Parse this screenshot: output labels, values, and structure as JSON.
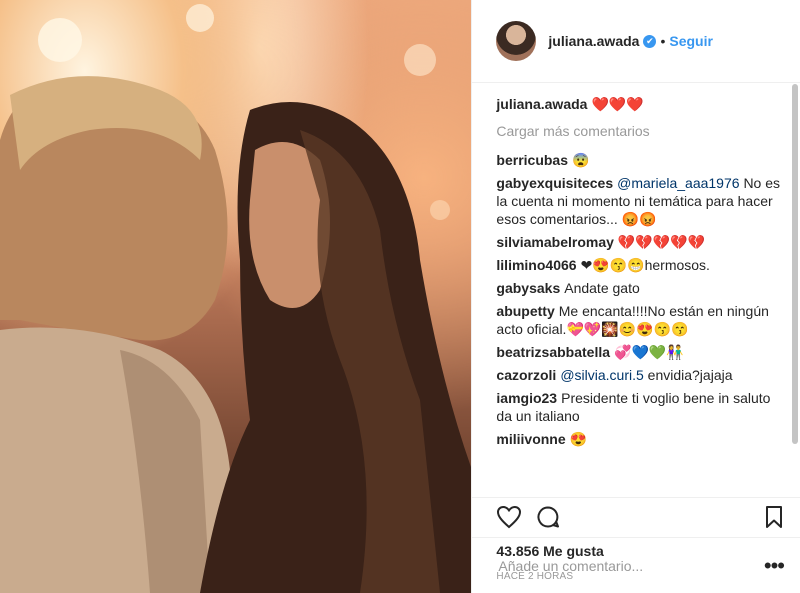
{
  "header": {
    "username": "juliana.awada",
    "follow_label": "Seguir",
    "verified_mark": "✔",
    "separator": "•"
  },
  "comments": {
    "load_more": "Cargar más comentarios",
    "caption": {
      "user": "juliana.awada",
      "text": "❤️❤️❤️"
    },
    "items": [
      {
        "user": "berricubas",
        "text": "😨"
      },
      {
        "user": "gabyexquisiteces",
        "mention": "@mariela_aaa1976",
        "text": "No es la cuenta ni momento ni temática para hacer esos comentarios... 😡😡"
      },
      {
        "user": "silviamabelromay",
        "text": "💔💔💔💔💔"
      },
      {
        "user": "lilimino4066",
        "text": "❤😍😙😁hermosos."
      },
      {
        "user": "gabysaks",
        "text": "Andate gato"
      },
      {
        "user": "abupetty",
        "text": "Me encanta!!!!No están en ningún acto oficial.💝💖🎇😊😍😙😙"
      },
      {
        "user": "beatrizsabbatella",
        "text": "💞💙💚👫"
      },
      {
        "user": "cazorzoli",
        "mention": "@silvia.curi.5",
        "text": "envidia?jajaja"
      },
      {
        "user": "iamgio23",
        "text": "Presidente ti voglio bene in saluto da un italiano"
      },
      {
        "user": "miliivonne",
        "text": "😍"
      }
    ]
  },
  "stats": {
    "likes": "43.856 Me gusta",
    "time": "HACE 2 HORAS"
  },
  "add_comment": {
    "placeholder": "Añade un comentario...",
    "more_label": "•••"
  },
  "icons": {
    "like": "heart-icon",
    "comment": "comment-icon",
    "save": "bookmark-icon"
  },
  "colors": {
    "link": "#3897f0",
    "muted": "#999999",
    "mention": "#003569"
  }
}
